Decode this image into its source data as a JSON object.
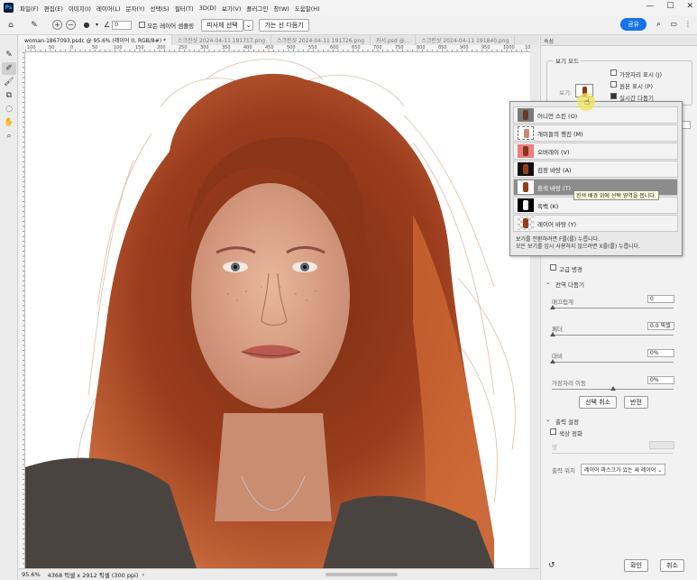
{
  "app": {
    "logo": "Ps"
  },
  "menu": [
    "파일(F)",
    "편집(E)",
    "이미지(I)",
    "레이어(L)",
    "문자(Y)",
    "선택(S)",
    "필터(T)",
    "3D(D)",
    "보기(V)",
    "플러그인",
    "창(W)",
    "도움말(H)"
  ],
  "window_controls": [
    "—",
    "☐",
    "✕"
  ],
  "options": {
    "size_value": "0",
    "sample_all_label": "모든 레이어 샘플링",
    "select_subject": "피사체 선택",
    "refine_hair": "가는 선 다듬기",
    "share": "공유"
  },
  "tabs": [
    "woman-1867093.psdc @ 95.6% (레이어 0, RGB/8#) *",
    "스크린샷 2024-04-11 191717.png",
    "스크린샷 2024-04-11 191726.png",
    "커서.psd @...",
    "스크린샷 2024-04-11 191840.png"
  ],
  "ruler": [
    "100",
    "50",
    "0",
    "50",
    "100",
    "150",
    "200",
    "250",
    "300",
    "350",
    "400",
    "450",
    "500",
    "550",
    "600",
    "650",
    "700",
    "750",
    "800",
    "850",
    "900",
    "950",
    "1000",
    "1050"
  ],
  "status": {
    "zoom": "95.6%",
    "info": "4368 픽셀 x 2912 픽셀 (300 ppi)"
  },
  "panel": {
    "tab": "속성",
    "view_mode_title": "보기 모드",
    "view_label": "보기:",
    "show_edge": "가장자리 표시 (J)",
    "show_original": "원본 표시 (P)",
    "realtime_refine": "실시간 다듬기",
    "hq_preview": "고급 병경",
    "global_refine": "전역 다듬기",
    "smooth_label": "매끄럽게",
    "smooth_value": "0",
    "feather_label": "페더",
    "feather_value": "0.0 픽셀",
    "contrast_label": "대비",
    "contrast_value": "0%",
    "shift_edge_label": "가장자리 이동",
    "shift_edge_value": "0%",
    "clear_selection": "선택 취소",
    "invert": "반전",
    "output_title": "출력 설정",
    "decontaminate": "색상 정화",
    "amount_label": "양",
    "output_to_label": "출력 위치",
    "output_to_value": "레이어 마스크가 있는 새 레이어",
    "ok": "확인",
    "cancel": "취소",
    "partial_value_1": "0%"
  },
  "view_popup": {
    "items": [
      {
        "label": "어니언 스킨 (O)",
        "thumb": "onion"
      },
      {
        "label": "개미들의 행진 (M)",
        "thumb": "ants"
      },
      {
        "label": "오버레이 (V)",
        "thumb": "overlay"
      },
      {
        "label": "검정 바탕 (A)",
        "thumb": "black"
      },
      {
        "label": "흰색 바탕 (T)",
        "thumb": "white"
      },
      {
        "label": "흑백 (K)",
        "thumb": "bw"
      },
      {
        "label": "레이어 바탕 (Y)",
        "thumb": "layer"
      }
    ],
    "note_line1": "보기를 전환하려면 F를(를) 누릅니다.",
    "note_line2": "모든 보기를 임시 사용하지 않으려면 X를(를) 누릅니다.",
    "tooltip": "흰색 배경 위에 선택 영역을 봅니다."
  },
  "colors": {
    "share_bg": "#1473e6",
    "hair": "#9a3c1c",
    "hair_light": "#d06b36",
    "sweater": "#4a4440",
    "skin": "#dfa488",
    "highlight": "#8c8c8c"
  }
}
